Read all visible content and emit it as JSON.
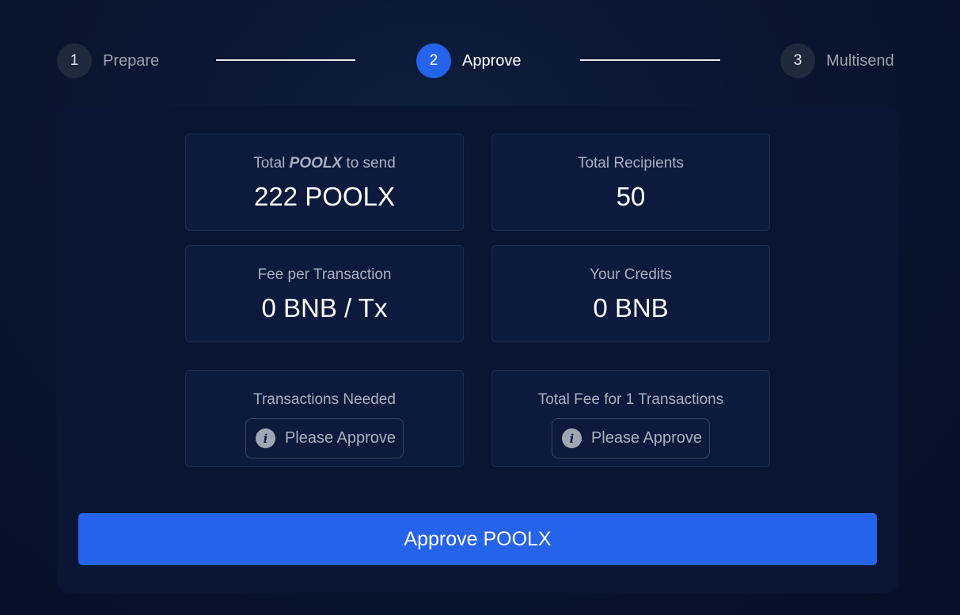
{
  "stepper": {
    "steps": [
      {
        "number": "1",
        "label": "Prepare",
        "state": "inactive"
      },
      {
        "number": "2",
        "label": "Approve",
        "state": "active"
      },
      {
        "number": "3",
        "label": "Multisend",
        "state": "inactive"
      }
    ]
  },
  "summary": {
    "total_to_send": {
      "label_prefix": "Total ",
      "label_token": "POOLX",
      "label_suffix": " to send",
      "value": "222 POOLX"
    },
    "total_recipients": {
      "label": "Total Recipients",
      "value": "50"
    },
    "fee_per_tx": {
      "label": "Fee per Transaction",
      "value": "0 BNB / Tx"
    },
    "your_credits": {
      "label": "Your Credits",
      "value": "0 BNB"
    },
    "transactions_needed": {
      "label": "Transactions Needed",
      "status": "Please Approve",
      "icon": "info-icon"
    },
    "total_fee": {
      "label": "Total Fee for 1 Transactions",
      "status": "Please Approve",
      "icon": "info-icon"
    }
  },
  "actions": {
    "approve_label": "Approve POOLX"
  },
  "colors": {
    "accent": "#2563eb",
    "panel": "#0a1533",
    "card": "#0c1a3d",
    "muted_text": "#a9b1c0"
  }
}
